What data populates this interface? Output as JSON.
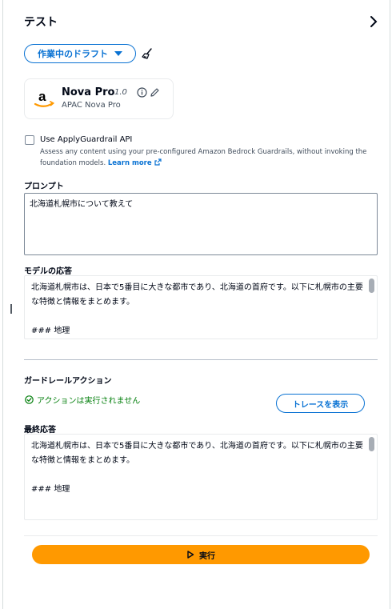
{
  "panel": {
    "title": "テスト"
  },
  "draft": {
    "label": "作業中のドラフト"
  },
  "model": {
    "name": "Nova Pro",
    "version": "1.0",
    "subtitle": "APAC Nova Pro"
  },
  "guardrail": {
    "checkbox_label": "Use ApplyGuardrail API",
    "description": "Assess any content using your pre-configured Amazon Bedrock Guardrails, without invoking the foundation models.",
    "learn_more": "Learn more",
    "checked": false
  },
  "prompt": {
    "label": "プロンプト",
    "value": "北海道札幌市について教えて"
  },
  "model_response": {
    "label": "モデルの応答",
    "text": "北海道札幌市は、日本で5番目に大きな都市であり、北海道の首府です。以下に札幌市の主要な特徴と情報をまとめます。\n\n### 地理"
  },
  "guardrail_action": {
    "label": "ガードレールアクション",
    "status": "アクションは実行されません",
    "trace_button": "トレースを表示"
  },
  "final_response": {
    "label": "最終応答",
    "text": "北海道札幌市は、日本で5番目に大きな都市であり、北海道の首府です。以下に札幌市の主要な特徴と情報をまとめます。\n\n### 地理"
  },
  "run_button": {
    "label": "実行"
  },
  "colors": {
    "accent_blue": "#0972d3",
    "run_orange": "#ff9900",
    "success_green": "#037f0c"
  }
}
